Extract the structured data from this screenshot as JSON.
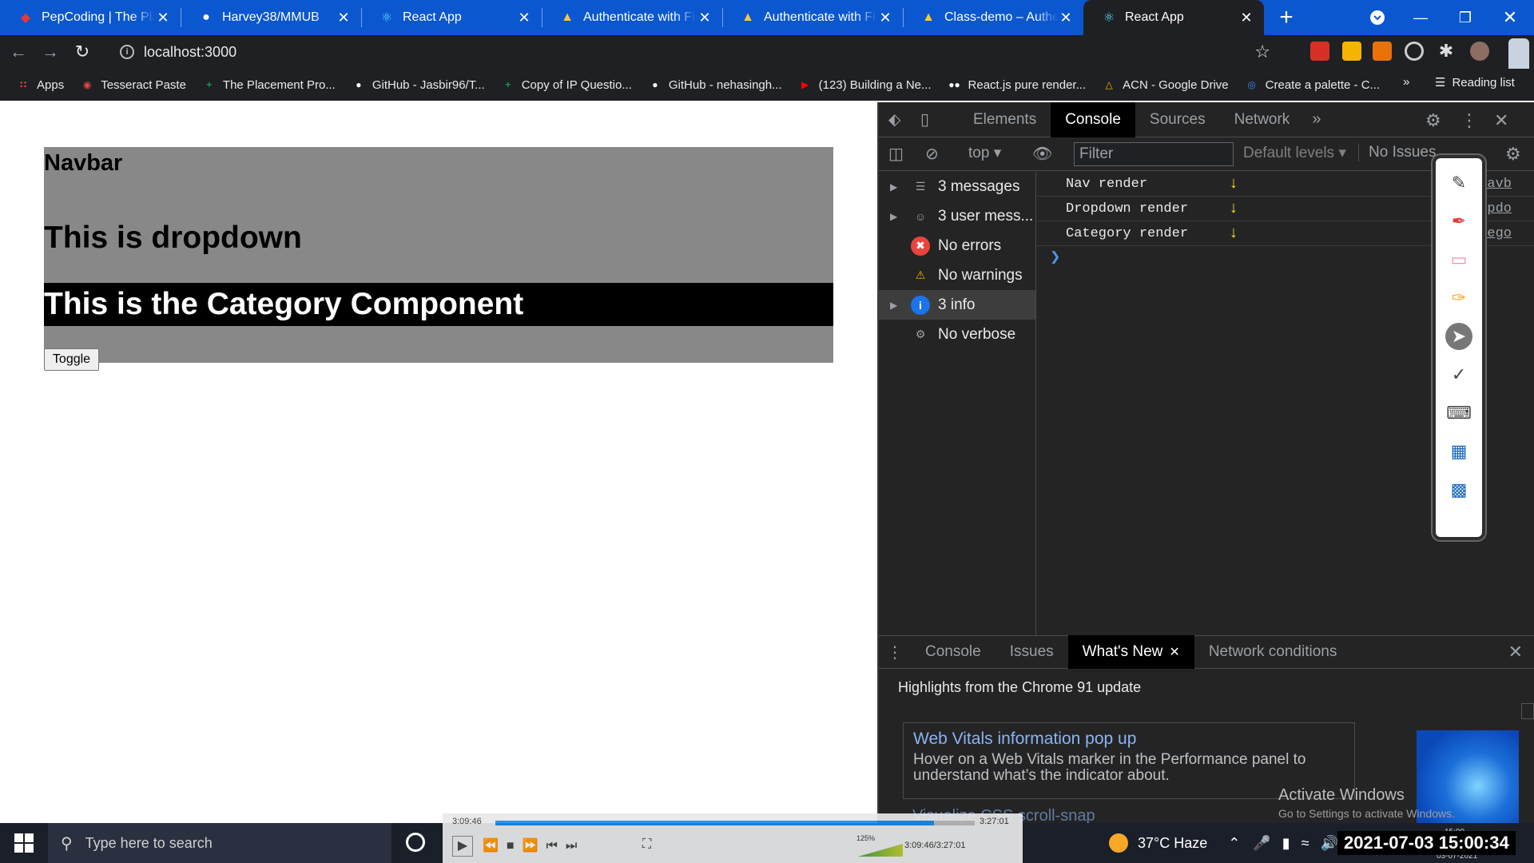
{
  "tabs": [
    {
      "title": "PepCoding | The Place",
      "icon": "pepcoding-icon"
    },
    {
      "title": "Harvey38/MMUB",
      "icon": "github-icon"
    },
    {
      "title": "React App",
      "icon": "react-icon"
    },
    {
      "title": "Authenticate with Fire",
      "icon": "firebase-icon"
    },
    {
      "title": "Authenticate with Fire",
      "icon": "firebase-icon"
    },
    {
      "title": "Class-demo – Authen",
      "icon": "firebase-icon"
    },
    {
      "title": "React App",
      "icon": "react-icon"
    }
  ],
  "active_tab_index": 6,
  "address": "localhost:3000",
  "bookmarks": [
    {
      "label": "Apps",
      "icon": "apps-grid-icon",
      "color": "#ea4335"
    },
    {
      "label": "Tesseract Paste",
      "icon": "tesseract-icon",
      "color": "#e8453c"
    },
    {
      "label": "The Placement Pro...",
      "icon": "sheets-icon",
      "color": "#0f9d58"
    },
    {
      "label": "GitHub - Jasbir96/T...",
      "icon": "github-icon",
      "color": "#ffffff"
    },
    {
      "label": "Copy of IP Questio...",
      "icon": "sheets-icon",
      "color": "#0f9d58"
    },
    {
      "label": "GitHub - nehasingh...",
      "icon": "github-icon",
      "color": "#ffffff"
    },
    {
      "label": "(123) Building a Ne...",
      "icon": "youtube-icon",
      "color": "#ff0000"
    },
    {
      "label": "React.js pure render...",
      "icon": "medium-icon",
      "color": "#ffffff"
    },
    {
      "label": "ACN - Google Drive",
      "icon": "drive-icon",
      "color": "#fbbc04"
    },
    {
      "label": "Create a palette - C...",
      "icon": "chrome-icon",
      "color": "#4285f4"
    }
  ],
  "bookmarks_more": "»",
  "reading_list": "Reading list",
  "page": {
    "navbar": "Navbar",
    "dropdown": "This is dropdown",
    "category": "This is the Category Component",
    "toggle": "Toggle"
  },
  "devtools": {
    "tabs": [
      "Elements",
      "Console",
      "Sources",
      "Network"
    ],
    "active_tab": "Console",
    "more": "»",
    "context": "top",
    "filter_placeholder": "Filter",
    "levels": "Default levels",
    "issues": "No Issues",
    "sidebar": [
      {
        "label": "3 messages",
        "icon": "list-icon",
        "expandable": true
      },
      {
        "label": "3 user mess...",
        "icon": "user-icon",
        "expandable": true
      },
      {
        "label": "No errors",
        "icon": "error-icon",
        "expandable": false
      },
      {
        "label": "No warnings",
        "icon": "warning-icon",
        "expandable": false
      },
      {
        "label": "3 info",
        "icon": "info-icon",
        "expandable": true
      },
      {
        "label": "No verbose",
        "icon": "bug-icon",
        "expandable": false
      }
    ],
    "selected_sidebar_index": 4,
    "logs": [
      {
        "message": "Nav render",
        "source": "Navb"
      },
      {
        "message": "Dropdown render",
        "source": "Dropdo"
      },
      {
        "message": "Category render",
        "source": "Catego"
      }
    ],
    "drawer_tabs": [
      "Console",
      "Issues",
      "What's New",
      "Network conditions"
    ],
    "drawer_active": "What's New",
    "highlights": "Highlights from the Chrome 91 update",
    "card_title": "Web Vitals information pop up",
    "card_body": "Hover on a Web Vitals marker in the Performance panel to understand what’s the indicator about.",
    "next_card_title": "Visualize CSS scroll-snap"
  },
  "activate": {
    "title": "Activate Windows",
    "subtitle": "Go to Settings to activate Windows."
  },
  "taskbar": {
    "search_placeholder": "Type here to search",
    "weather": "37°C Haze",
    "datetime": "2021-07-03 15:00:34",
    "clock_small": "15:00",
    "date_small": "03-07-2021"
  },
  "media": {
    "elapsed": "3:09:46",
    "total": "3:27:01",
    "position": "3:09:46/3:27:01",
    "volume": "125%",
    "progress": 0.915
  }
}
